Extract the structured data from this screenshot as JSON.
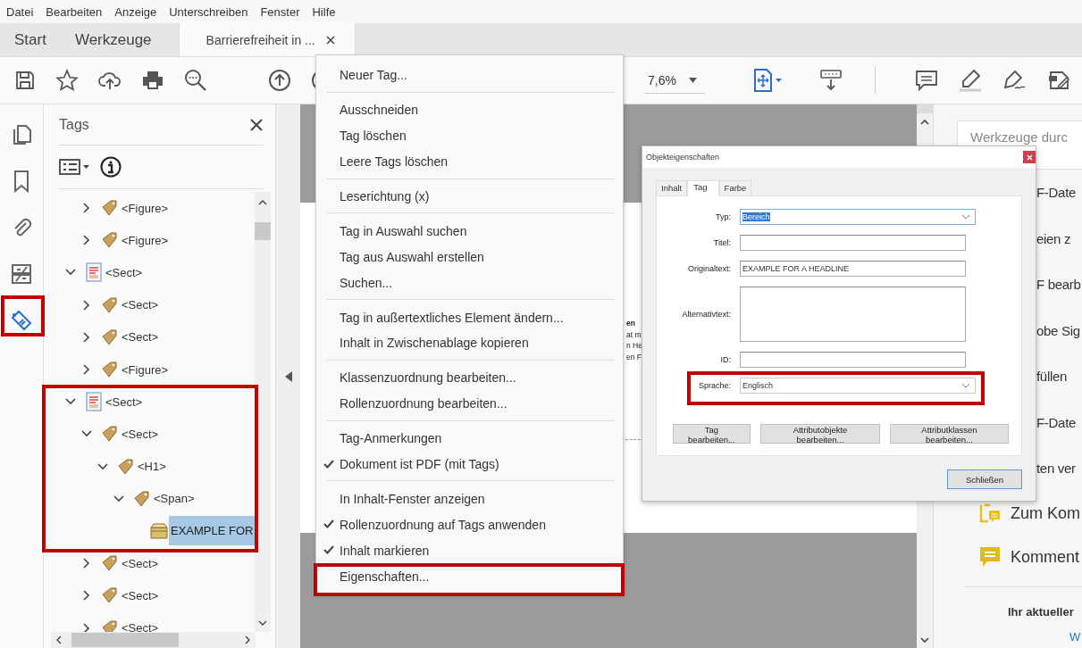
{
  "menu_bar": [
    "Datei",
    "Bearbeiten",
    "Anzeige",
    "Unterschreiben",
    "Fenster",
    "Hilfe"
  ],
  "tabs": [
    {
      "label": "Start",
      "selected": false,
      "closable": false
    },
    {
      "label": "Werkzeuge",
      "selected": false,
      "closable": false
    },
    {
      "label": "Barrierefreiheit in ...",
      "selected": true,
      "closable": true
    }
  ],
  "toolbar": {
    "zoom": "7,6%"
  },
  "sidebar_tools": [
    {
      "kind": "pages",
      "selected": false
    },
    {
      "kind": "bookmarks",
      "selected": false
    },
    {
      "kind": "attachments",
      "selected": false
    },
    {
      "kind": "compare",
      "selected": false
    },
    {
      "kind": "tags",
      "selected": true
    }
  ],
  "tags_panel": {
    "title": "Tags",
    "tree": [
      {
        "kind": "continued",
        "children": [
          {
            "kind": "tag",
            "label": "<Figure>",
            "expanded": false,
            "selected": false
          },
          {
            "kind": "tag",
            "label": "<Figure>",
            "expanded": false,
            "selected": false
          }
        ]
      },
      {
        "kind": "section",
        "label": "<Sect>",
        "expanded": true,
        "selected": false,
        "children": [
          {
            "kind": "tag",
            "label": "<Sect>",
            "expanded": false,
            "selected": false
          },
          {
            "kind": "tag",
            "label": "<Sect>",
            "expanded": false,
            "selected": false
          },
          {
            "kind": "tag",
            "label": "<Figure>",
            "expanded": false,
            "selected": false
          }
        ]
      },
      {
        "kind": "section",
        "label": "<Sect>",
        "expanded": true,
        "selected": false,
        "children": [
          {
            "kind": "tag",
            "label": "<Sect>",
            "expanded": true,
            "selected": false,
            "children": [
              {
                "kind": "tag",
                "label": "<H1>",
                "expanded": true,
                "selected": false,
                "children": [
                  {
                    "kind": "tag",
                    "label": "<Span>",
                    "expanded": true,
                    "selected": false,
                    "children": [
                      {
                        "kind": "content",
                        "label": "EXAMPLE FOR",
                        "selected": true
                      }
                    ]
                  }
                ]
              }
            ]
          },
          {
            "kind": "tag",
            "label": "<Sect>",
            "expanded": false,
            "selected": false
          },
          {
            "kind": "tag",
            "label": "<Sect>",
            "expanded": false,
            "selected": false
          },
          {
            "kind": "tag",
            "label": "<Sect>",
            "expanded": false,
            "selected": false
          }
        ]
      }
    ]
  },
  "document": {
    "fragments": [
      {
        "text": "en",
        "bold": true
      },
      {
        "text": "at m",
        "bold": false
      },
      {
        "text": "n He",
        "bold": false
      },
      {
        "text": "en F",
        "bold": false
      }
    ]
  },
  "context_menu": {
    "groups": [
      [
        {
          "label": "Neuer Tag...",
          "checked": false
        }
      ],
      [
        {
          "label": "Ausschneiden",
          "checked": false
        },
        {
          "label": "Tag löschen",
          "checked": false
        },
        {
          "label": "Leere Tags löschen",
          "checked": false
        }
      ],
      [
        {
          "label": "Leserichtung (x)",
          "checked": false
        }
      ],
      [
        {
          "label": "Tag in Auswahl suchen",
          "checked": false
        },
        {
          "label": "Tag aus Auswahl erstellen",
          "checked": false
        },
        {
          "label": "Suchen...",
          "checked": false
        }
      ],
      [
        {
          "label": "Tag in außertextliches Element ändern...",
          "checked": false
        },
        {
          "label": "Inhalt in Zwischenablage kopieren",
          "checked": false
        }
      ],
      [
        {
          "label": "Klassenzuordnung bearbeiten...",
          "checked": false
        },
        {
          "label": "Rollenzuordnung bearbeiten...",
          "checked": false
        }
      ],
      [
        {
          "label": "Tag-Anmerkungen",
          "checked": false
        },
        {
          "label": "Dokument ist PDF (mit Tags)",
          "checked": true
        }
      ],
      [
        {
          "label": "In Inhalt-Fenster anzeigen",
          "checked": false
        },
        {
          "label": "Rollenzuordnung auf Tags anwenden",
          "checked": true
        },
        {
          "label": "Inhalt markieren",
          "checked": true
        },
        {
          "label": "Eigenschaften...",
          "checked": false
        }
      ]
    ]
  },
  "dialog": {
    "title": "Objekteigenschaften",
    "tabs": [
      {
        "label": "Inhalt",
        "selected": false
      },
      {
        "label": "Tag",
        "selected": true
      },
      {
        "label": "Farbe",
        "selected": false
      }
    ],
    "fields": [
      {
        "label": "Typ:",
        "kind": "dropdown",
        "value": "Bereich",
        "focused": true
      },
      {
        "label": "Titel:",
        "kind": "text",
        "focused": false
      },
      {
        "label": "Originaltext:",
        "kind": "text",
        "value": "EXAMPLE FOR A HEADLINE",
        "focused": false
      },
      {
        "label": "Alternativtext:",
        "kind": "textarea",
        "focused": false
      },
      {
        "label": "ID:",
        "kind": "text",
        "focused": false
      },
      {
        "label": "Sprache:",
        "kind": "dropdown",
        "value": "Englisch",
        "focused": false
      }
    ],
    "buttons": [
      "Tag bearbeiten...",
      "Attributobjekte bearbeiten...",
      "Attributklassen bearbeiten..."
    ],
    "close_button": "Schließen"
  },
  "right_panel": {
    "search": {
      "placeholder": "Werkzeuge durc"
    },
    "tools": [
      {
        "label": "F-Date",
        "kind": "covered"
      },
      {
        "label": "eien z",
        "kind": "covered"
      },
      {
        "label": "F bearb",
        "kind": "covered"
      },
      {
        "label": "obe Sig",
        "kind": "covered"
      },
      {
        "label": "füllen",
        "kind": "covered"
      },
      {
        "label": "F-Date",
        "kind": "covered"
      },
      {
        "label": "ten ver",
        "kind": "covered"
      },
      {
        "label": "Zum Kom",
        "kind": "share"
      },
      {
        "label": "Komment",
        "kind": "comment"
      }
    ],
    "plan_label": "Ihr aktueller",
    "link": "W"
  }
}
